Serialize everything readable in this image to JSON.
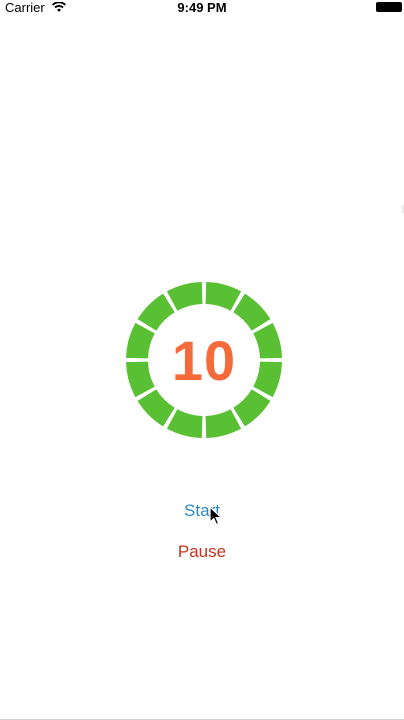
{
  "status_bar": {
    "carrier": "Carrier",
    "time": "9:49 PM",
    "wifi_icon": "wifi-icon",
    "battery_icon": "battery-icon"
  },
  "timer": {
    "count": "10",
    "segments_total": 12,
    "segments_filled": 12,
    "ring_color": "#58c032",
    "number_color": "#f46a3b"
  },
  "buttons": {
    "start_label": "Start",
    "pause_label": "Pause",
    "start_color": "#2a87c9",
    "pause_color": "#c8321e"
  }
}
